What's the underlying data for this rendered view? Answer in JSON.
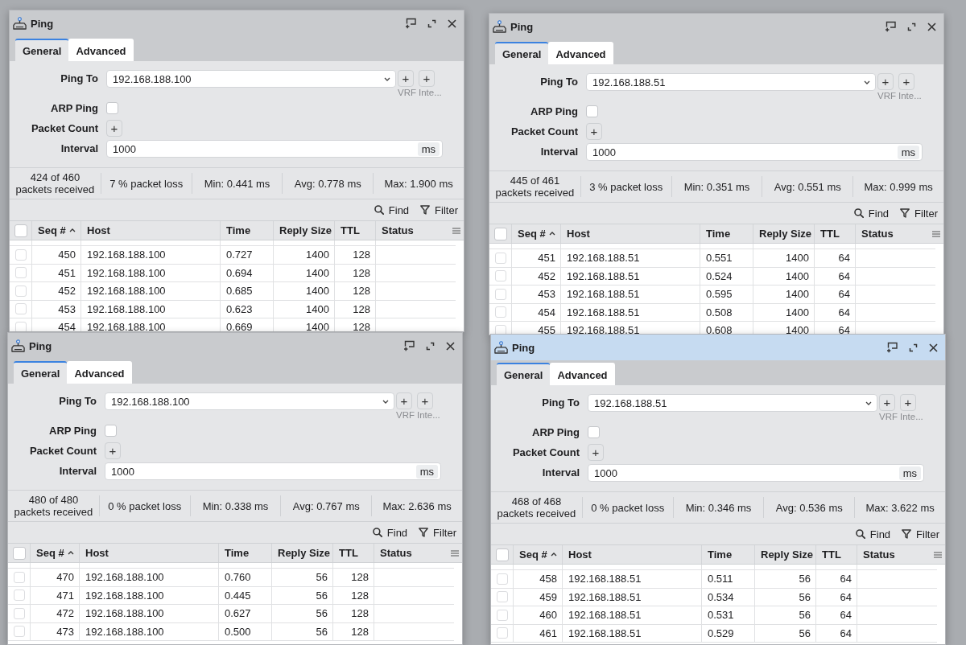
{
  "windows": [
    {
      "title": "Ping",
      "active": false,
      "tabs": [
        {
          "label": "General",
          "selected": true
        },
        {
          "label": "Advanced",
          "selected": false
        }
      ],
      "fields": [
        {
          "kind": "select",
          "label": "Ping To",
          "value": "192.168.188.100",
          "addons": [
            {
              "symbol": "+",
              "caption": "VRF"
            },
            {
              "symbol": "+",
              "caption": "Inte..."
            }
          ]
        },
        {
          "kind": "checkbox",
          "label": "ARP Ping",
          "checked": false
        },
        {
          "kind": "add",
          "label": "Packet Count",
          "symbol": "+"
        },
        {
          "kind": "input",
          "label": "Interval",
          "value": "1000",
          "unit": "ms"
        }
      ],
      "stats": [
        "424 of 460 packets received",
        "7 % packet loss",
        "Min: 0.441 ms",
        "Avg: 0.778 ms",
        "Max: 1.900 ms"
      ],
      "toolbar": [
        {
          "kind": "find",
          "label": "Find"
        },
        {
          "kind": "filter",
          "label": "Filter"
        }
      ],
      "table": {
        "all_checked": false,
        "columns": [
          {
            "label": "Seq #",
            "sorted": true
          },
          {
            "label": "Host",
            "sorted": false
          },
          {
            "label": "Time",
            "sorted": false
          },
          {
            "label": "Reply Size",
            "sorted": false
          },
          {
            "label": "TTL",
            "sorted": false
          },
          {
            "label": "Status",
            "sorted": false
          }
        ],
        "rows": [
          {
            "checked": false,
            "cells": [
              "450",
              "192.168.188.100",
              "0.727",
              "1400",
              "128"
            ]
          },
          {
            "checked": false,
            "cells": [
              "451",
              "192.168.188.100",
              "0.694",
              "1400",
              "128"
            ]
          },
          {
            "checked": false,
            "cells": [
              "452",
              "192.168.188.100",
              "0.685",
              "1400",
              "128"
            ]
          },
          {
            "checked": false,
            "cells": [
              "453",
              "192.168.188.100",
              "0.623",
              "1400",
              "128"
            ]
          },
          {
            "checked": false,
            "cells": [
              "454",
              "192.168.188.100",
              "0.669",
              "1400",
              "128"
            ]
          }
        ]
      }
    },
    {
      "title": "Ping",
      "active": false,
      "tabs": [
        {
          "label": "General",
          "selected": true
        },
        {
          "label": "Advanced",
          "selected": false
        }
      ],
      "fields": [
        {
          "kind": "select",
          "label": "Ping To",
          "value": "192.168.188.51",
          "addons": [
            {
              "symbol": "+",
              "caption": "VRF"
            },
            {
              "symbol": "+",
              "caption": "Inte..."
            }
          ]
        },
        {
          "kind": "checkbox",
          "label": "ARP Ping",
          "checked": false
        },
        {
          "kind": "add",
          "label": "Packet Count",
          "symbol": "+"
        },
        {
          "kind": "input",
          "label": "Interval",
          "value": "1000",
          "unit": "ms"
        }
      ],
      "stats": [
        "445 of 461 packets received",
        "3 % packet loss",
        "Min: 0.351 ms",
        "Avg: 0.551 ms",
        "Max: 0.999 ms"
      ],
      "toolbar": [
        {
          "kind": "find",
          "label": "Find"
        },
        {
          "kind": "filter",
          "label": "Filter"
        }
      ],
      "table": {
        "all_checked": false,
        "columns": [
          {
            "label": "Seq #",
            "sorted": true
          },
          {
            "label": "Host",
            "sorted": false
          },
          {
            "label": "Time",
            "sorted": false
          },
          {
            "label": "Reply Size",
            "sorted": false
          },
          {
            "label": "TTL",
            "sorted": false
          },
          {
            "label": "Status",
            "sorted": false
          }
        ],
        "rows": [
          {
            "checked": false,
            "cells": [
              "451",
              "192.168.188.51",
              "0.551",
              "1400",
              "64"
            ]
          },
          {
            "checked": false,
            "cells": [
              "452",
              "192.168.188.51",
              "0.524",
              "1400",
              "64"
            ]
          },
          {
            "checked": false,
            "cells": [
              "453",
              "192.168.188.51",
              "0.595",
              "1400",
              "64"
            ]
          },
          {
            "checked": false,
            "cells": [
              "454",
              "192.168.188.51",
              "0.508",
              "1400",
              "64"
            ]
          },
          {
            "checked": false,
            "cells": [
              "455",
              "192.168.188.51",
              "0.608",
              "1400",
              "64"
            ]
          }
        ]
      }
    },
    {
      "title": "Ping",
      "active": false,
      "tabs": [
        {
          "label": "General",
          "selected": true
        },
        {
          "label": "Advanced",
          "selected": false
        }
      ],
      "fields": [
        {
          "kind": "select",
          "label": "Ping To",
          "value": "192.168.188.100",
          "addons": [
            {
              "symbol": "+",
              "caption": "VRF"
            },
            {
              "symbol": "+",
              "caption": "Inte..."
            }
          ]
        },
        {
          "kind": "checkbox",
          "label": "ARP Ping",
          "checked": false
        },
        {
          "kind": "add",
          "label": "Packet Count",
          "symbol": "+"
        },
        {
          "kind": "input",
          "label": "Interval",
          "value": "1000",
          "unit": "ms"
        }
      ],
      "stats": [
        "480 of 480 packets received",
        "0 % packet loss",
        "Min: 0.338 ms",
        "Avg: 0.767 ms",
        "Max: 2.636 ms"
      ],
      "toolbar": [
        {
          "kind": "find",
          "label": "Find"
        },
        {
          "kind": "filter",
          "label": "Filter"
        }
      ],
      "table": {
        "all_checked": false,
        "columns": [
          {
            "label": "Seq #",
            "sorted": true
          },
          {
            "label": "Host",
            "sorted": false
          },
          {
            "label": "Time",
            "sorted": false
          },
          {
            "label": "Reply Size",
            "sorted": false
          },
          {
            "label": "TTL",
            "sorted": false
          },
          {
            "label": "Status",
            "sorted": false
          }
        ],
        "rows": [
          {
            "checked": false,
            "cells": [
              "470",
              "192.168.188.100",
              "0.760",
              "56",
              "128"
            ]
          },
          {
            "checked": false,
            "cells": [
              "471",
              "192.168.188.100",
              "0.445",
              "56",
              "128"
            ]
          },
          {
            "checked": false,
            "cells": [
              "472",
              "192.168.188.100",
              "0.627",
              "56",
              "128"
            ]
          },
          {
            "checked": false,
            "cells": [
              "473",
              "192.168.188.100",
              "0.500",
              "56",
              "128"
            ]
          }
        ]
      }
    },
    {
      "title": "Ping",
      "active": true,
      "tabs": [
        {
          "label": "General",
          "selected": true
        },
        {
          "label": "Advanced",
          "selected": false
        }
      ],
      "fields": [
        {
          "kind": "select",
          "label": "Ping To",
          "value": "192.168.188.51",
          "addons": [
            {
              "symbol": "+",
              "caption": "VRF"
            },
            {
              "symbol": "+",
              "caption": "Inte..."
            }
          ]
        },
        {
          "kind": "checkbox",
          "label": "ARP Ping",
          "checked": false
        },
        {
          "kind": "add",
          "label": "Packet Count",
          "symbol": "+"
        },
        {
          "kind": "input",
          "label": "Interval",
          "value": "1000",
          "unit": "ms"
        }
      ],
      "stats": [
        "468 of 468 packets received",
        "0 % packet loss",
        "Min: 0.346 ms",
        "Avg: 0.536 ms",
        "Max: 3.622 ms"
      ],
      "toolbar": [
        {
          "kind": "find",
          "label": "Find"
        },
        {
          "kind": "filter",
          "label": "Filter"
        }
      ],
      "table": {
        "all_checked": false,
        "columns": [
          {
            "label": "Seq #",
            "sorted": true
          },
          {
            "label": "Host",
            "sorted": false
          },
          {
            "label": "Time",
            "sorted": false
          },
          {
            "label": "Reply Size",
            "sorted": false
          },
          {
            "label": "TTL",
            "sorted": false
          },
          {
            "label": "Status",
            "sorted": false
          }
        ],
        "rows": [
          {
            "checked": false,
            "cells": [
              "458",
              "192.168.188.51",
              "0.511",
              "56",
              "64"
            ]
          },
          {
            "checked": false,
            "cells": [
              "459",
              "192.168.188.51",
              "0.534",
              "56",
              "64"
            ]
          },
          {
            "checked": false,
            "cells": [
              "460",
              "192.168.188.51",
              "0.531",
              "56",
              "64"
            ]
          },
          {
            "checked": false,
            "cells": [
              "461",
              "192.168.188.51",
              "0.529",
              "56",
              "64"
            ]
          }
        ]
      }
    }
  ]
}
